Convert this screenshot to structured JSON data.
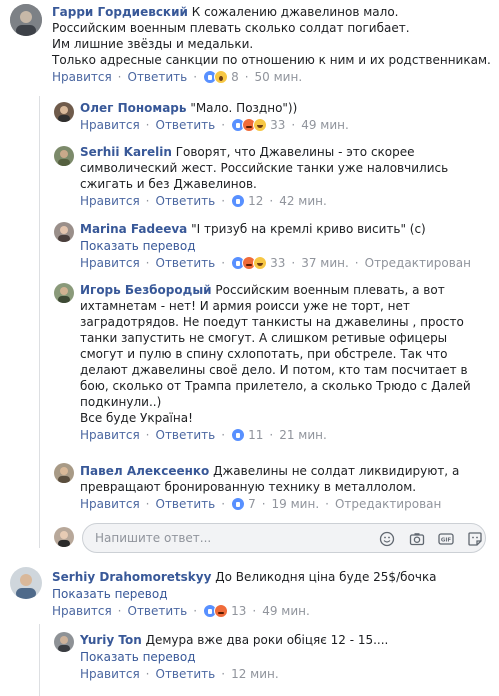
{
  "comments": [
    {
      "author": "Гарри Гордиевский",
      "text": "К сожалению джавелинов мало.\nРоссийским военным плевать сколько солдат погибает.\nИм лишние звёзды и медальки.\nТолько адресные санкции по отношению к ним и их родственникам.",
      "like": "Нравится",
      "reply": "Ответить",
      "count": "8",
      "time": "50 мин."
    },
    {
      "author": "Олег Пономарь",
      "text": "\"Мало. Поздно\"))",
      "like": "Нравится",
      "reply": "Ответить",
      "count": "33",
      "time": "49 мин."
    },
    {
      "author": "Serhii Karelin",
      "text": "Говорят, что Джавелины - это скорее символический жест. Российские танки уже наловчились сжигать и без Джавелинов.",
      "like": "Нравится",
      "reply": "Ответить",
      "count": "12",
      "time": "42 мин."
    },
    {
      "author": "Marina Fadeeva",
      "text": "\"I тризуб на кремлі криво висить\" (с)",
      "translate": "Показать перевод",
      "like": "Нравится",
      "reply": "Ответить",
      "count": "33",
      "time": "37 мин.",
      "edited": "Отредактирован"
    },
    {
      "author": "Игорь Безбородый",
      "text": "Российским военным плевать, а вот ихтамнетам - нет! И армия роисси уже не торт, нет заградотрядов. Не поедут танкисты на джавелины , просто танки запустить не смогут. А слишком ретивые офицеры смогут и пулю в спину схлопотать, при обстреле. Так что делают джавелины своё дело. И потом, кто там посчитает в бою, сколько от Трампа прилетело, а сколько Трюдо с Далей подкинули..)\nВсе буде Україна!",
      "like": "Нравится",
      "reply": "Ответить",
      "count": "11",
      "time": "21 мин."
    },
    {
      "author": "Павел Алексеенко",
      "text": "Джавелины не солдат ликвидируют, а превращают бронированную технику в металлолом.",
      "like": "Нравится",
      "reply": "Ответить",
      "count": "7",
      "time": "19 мин.",
      "edited": "Отредактирован"
    },
    {
      "author": "Serhiy Drahomoretskyy",
      "text": "До Великодня ціна буде 25$/бочка",
      "translate": "Показать перевод",
      "like": "Нравится",
      "reply": "Ответить",
      "count": "13",
      "time": "49 мин."
    },
    {
      "author": "Yuriy Ton",
      "text": "Демура вже два роки обіцяє 12 - 15....",
      "translate": "Показать перевод",
      "like": "Нравится",
      "reply": "Ответить",
      "time": "12 мин."
    }
  ],
  "reply_input": {
    "placeholder": "Напишите ответ..."
  },
  "icons": [
    "emoji-icon",
    "camera-icon",
    "gif-icon",
    "sticker-icon"
  ],
  "colors": {
    "link": "#385898",
    "meta": "#90949c",
    "like_blue": "#5890ff"
  }
}
